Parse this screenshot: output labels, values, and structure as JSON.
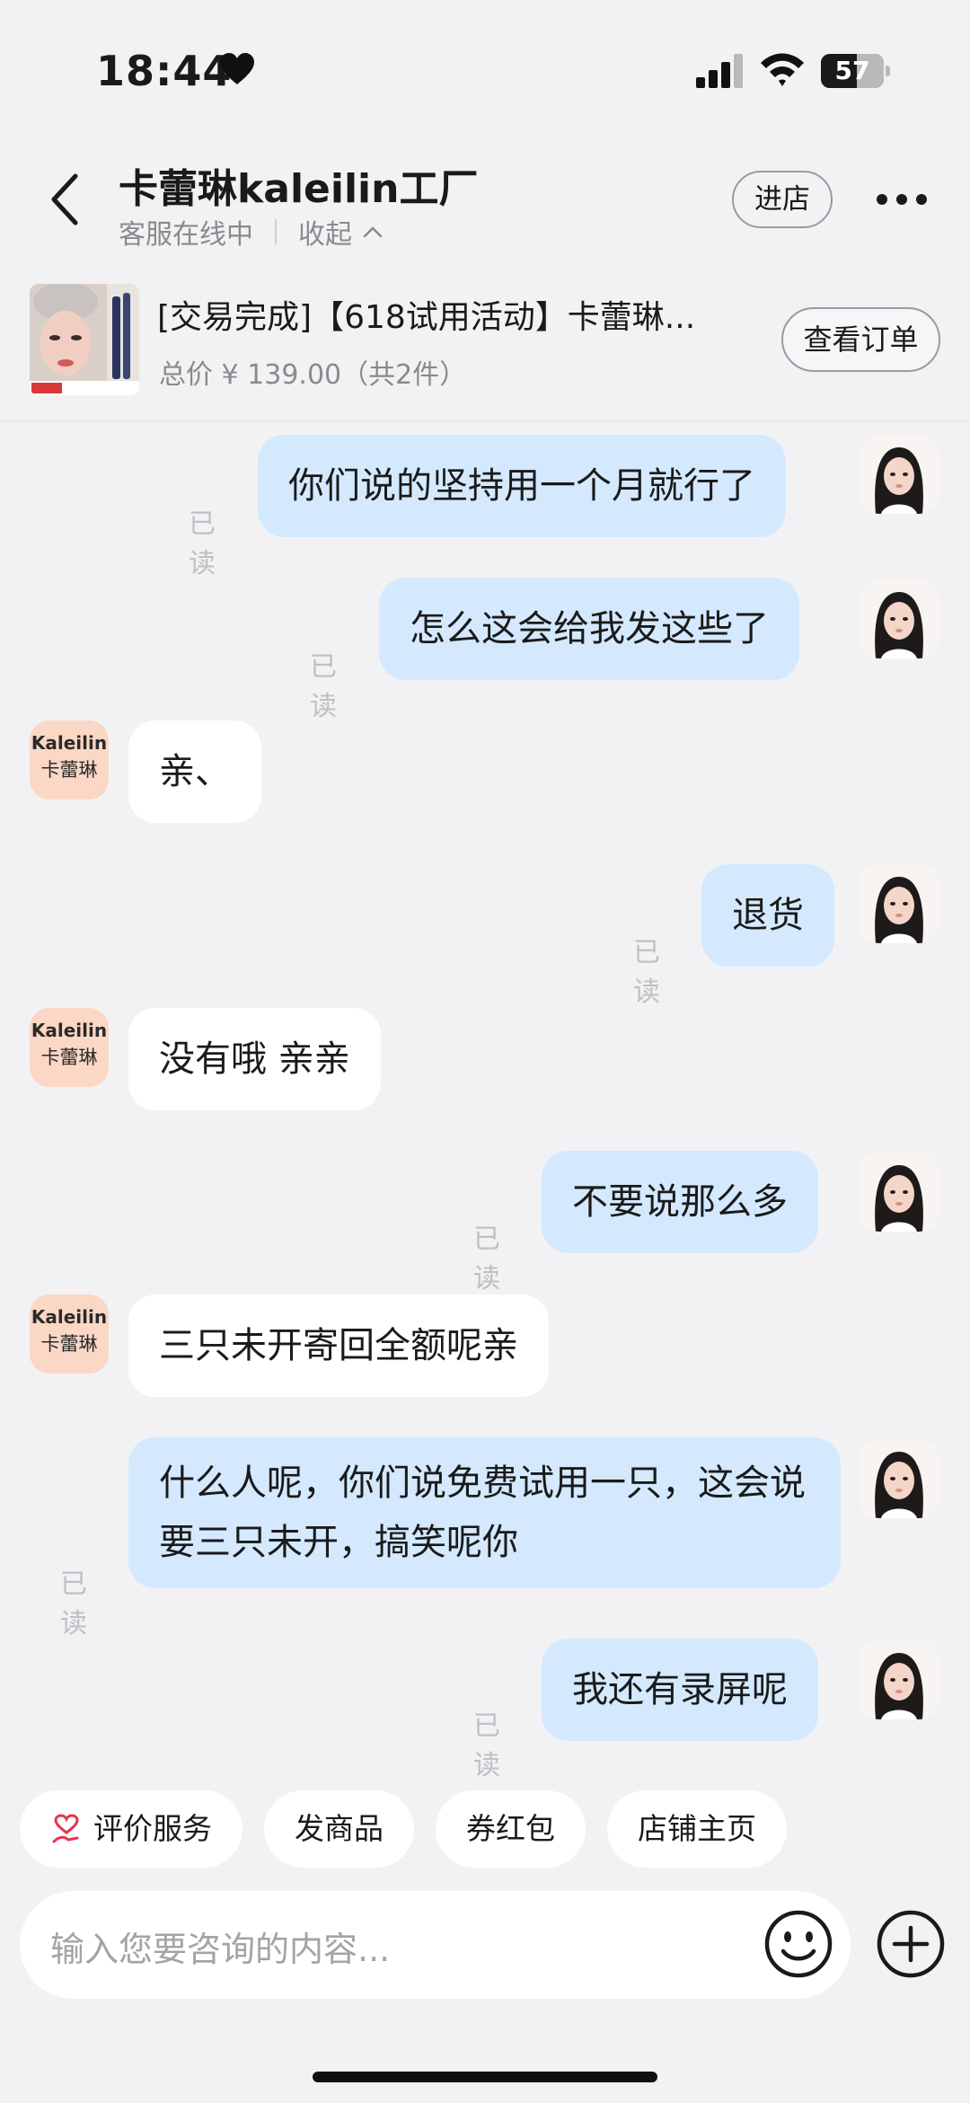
{
  "status_bar": {
    "time": "18:44",
    "battery": "57",
    "battery_fraction": 0.57
  },
  "header": {
    "shop_name": "卡蕾琳kaleilin工厂",
    "service_status": "客服在线中",
    "collapse_label": "收起",
    "enter_store_label": "进店"
  },
  "order": {
    "title": "[交易完成]【618试用活动】卡蕾琳...",
    "price_text": "总价 ¥ 139.00（共2件）",
    "view_order_label": "查看订单"
  },
  "shop_avatar": {
    "line1": "Kaleilin",
    "line2": "卡蕾琳"
  },
  "messages": [
    {
      "side": "me",
      "text": "你们说的坚持用一个月就行了",
      "read": "已读"
    },
    {
      "side": "me",
      "text": "怎么这会给我发这些了",
      "read": "已读"
    },
    {
      "side": "them",
      "text": "亲、"
    },
    {
      "side": "me",
      "text": "退货",
      "read": "已读"
    },
    {
      "side": "them",
      "text": "没有哦 亲亲"
    },
    {
      "side": "me",
      "text": "不要说那么多",
      "read": "已读"
    },
    {
      "side": "them",
      "text": "三只未开寄回全额呢亲"
    },
    {
      "side": "me",
      "text": "什么人呢，你们说免费试用一只，这会说要三只未开，搞笑呢你",
      "read": "已读"
    },
    {
      "side": "me",
      "text": "我还有录屏呢",
      "read": "已读"
    }
  ],
  "quick_actions": [
    "评价服务",
    "发商品",
    "券红包",
    "店铺主页"
  ],
  "input": {
    "placeholder": "输入您要咨询的内容..."
  },
  "colors": {
    "my_bubble": "#d4e9fd",
    "their_bubble": "#ffffff",
    "background": "#f2f2f4",
    "accent_red": "#e8334a"
  }
}
